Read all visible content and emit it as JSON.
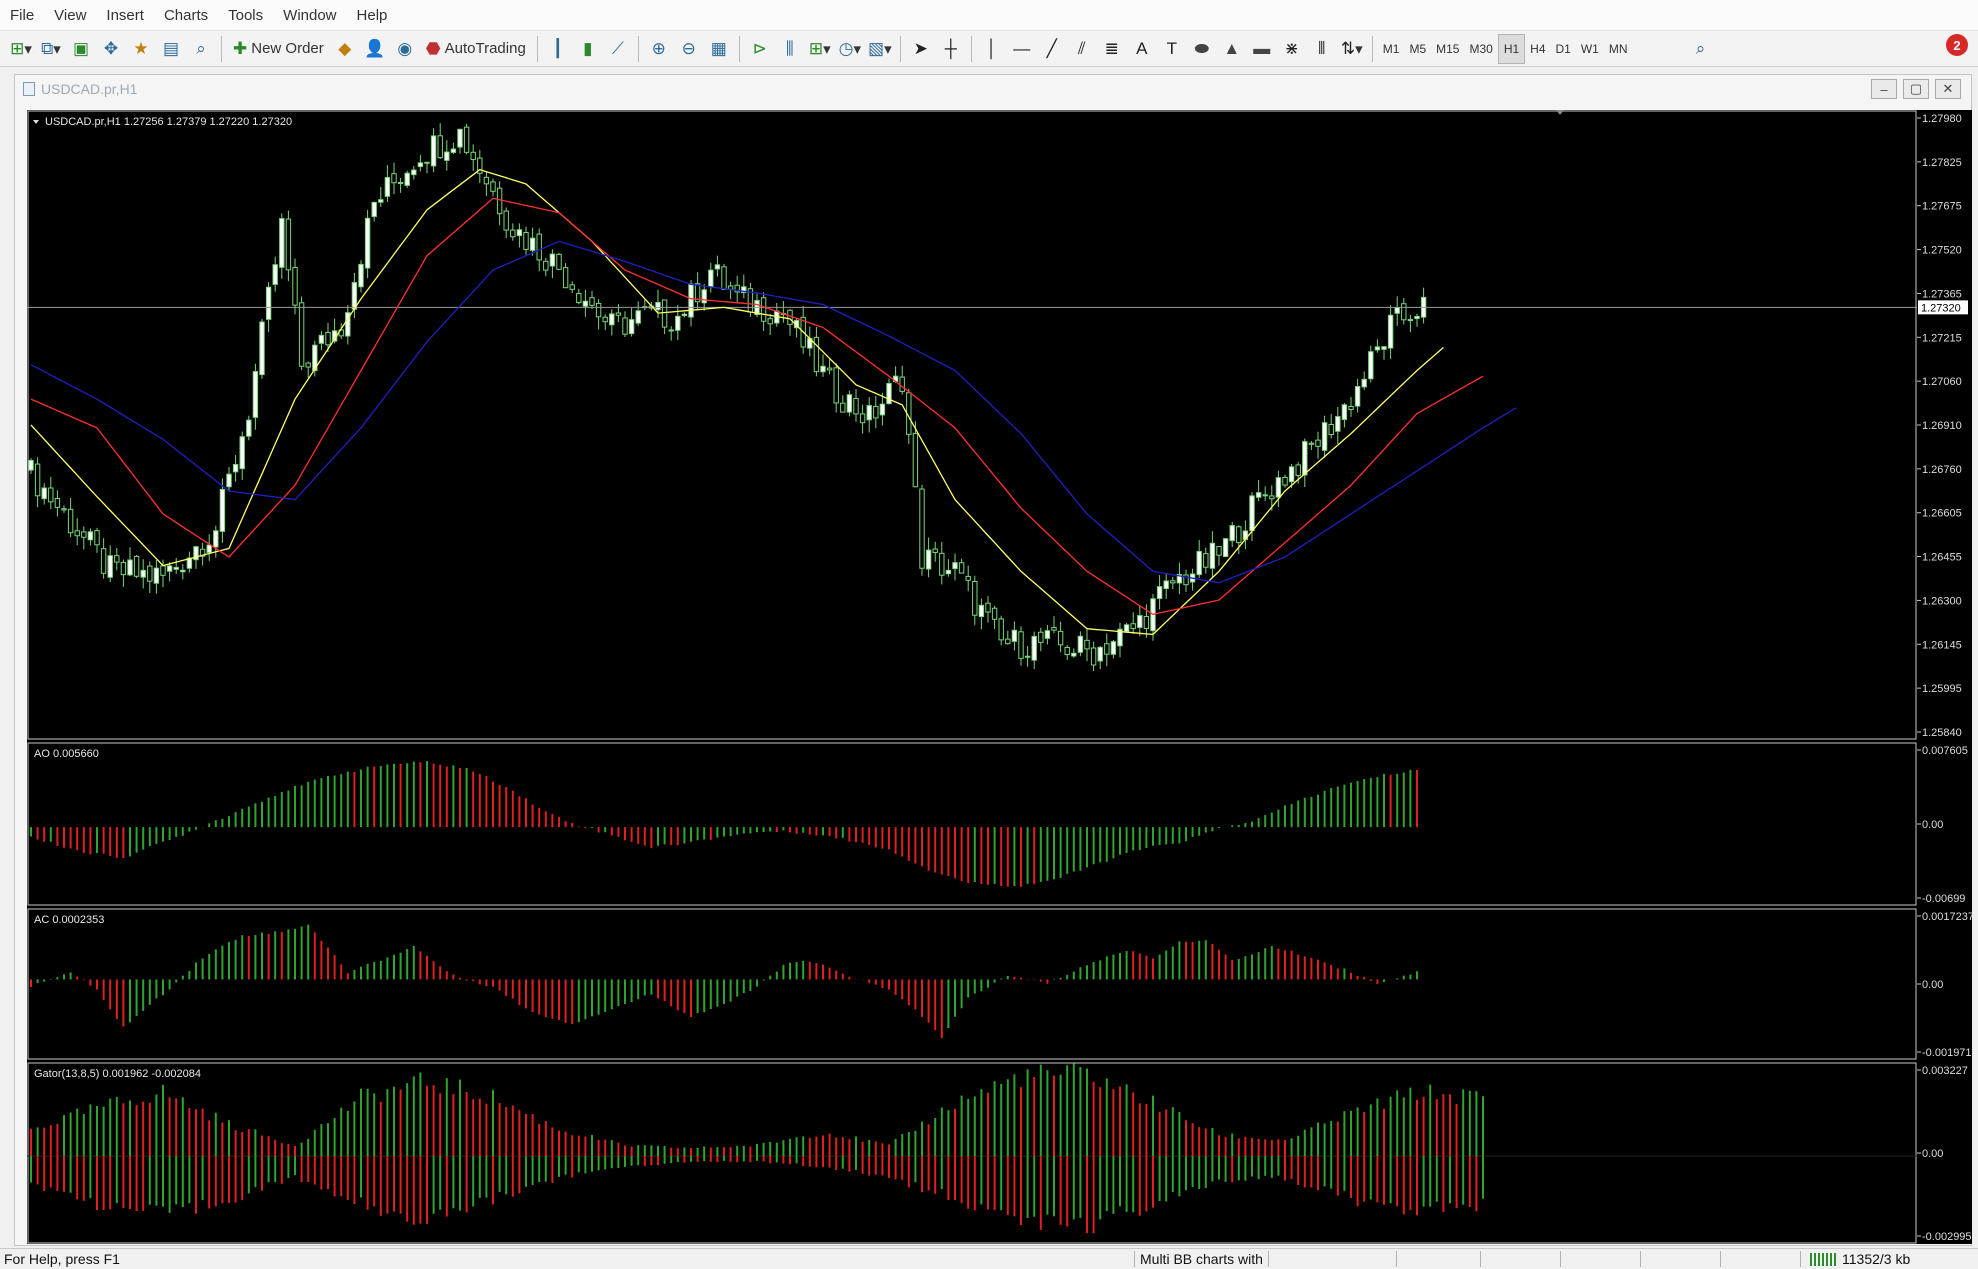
{
  "menu": [
    "File",
    "View",
    "Insert",
    "Charts",
    "Tools",
    "Window",
    "Help"
  ],
  "toolbar": {
    "new_order_label": "New Order",
    "autotrading_label": "AutoTrading",
    "timeframes": [
      "M1",
      "M5",
      "M15",
      "M30",
      "H1",
      "H4",
      "D1",
      "W1",
      "MN"
    ],
    "active_timeframe": "H1",
    "notification_count": "2"
  },
  "window": {
    "title": "USDCAD.pr,H1",
    "minimize": "–",
    "restore": "▢",
    "close": "✕"
  },
  "chart_data": [
    {
      "type": "candlestick",
      "title": "USDCAD.pr,H1 1.27256 1.27379 1.27220 1.27320",
      "current_price": 1.2732,
      "current_price_label": "1.27320",
      "y_ticks": [
        "1.27980",
        "1.27825",
        "1.27675",
        "1.27520",
        "1.27365",
        "1.27215",
        "1.27060",
        "1.26910",
        "1.26760",
        "1.26605",
        "1.26455",
        "1.26300",
        "1.26145",
        "1.25995",
        "1.25840"
      ],
      "ylim": [
        1.2584,
        1.2798
      ],
      "anchors": [
        [
          0,
          1.2674
        ],
        [
          5,
          1.266
        ],
        [
          12,
          1.264
        ],
        [
          20,
          1.2638
        ],
        [
          28,
          1.2655
        ],
        [
          33,
          1.2696
        ],
        [
          38,
          1.276
        ],
        [
          41,
          1.2712
        ],
        [
          47,
          1.2726
        ],
        [
          52,
          1.2768
        ],
        [
          59,
          1.2786
        ],
        [
          65,
          1.2793
        ],
        [
          73,
          1.276
        ],
        [
          80,
          1.2746
        ],
        [
          88,
          1.2725
        ],
        [
          93,
          1.2729
        ],
        [
          98,
          1.2729
        ],
        [
          103,
          1.2745
        ],
        [
          107,
          1.2735
        ],
        [
          114,
          1.273
        ],
        [
          121,
          1.2705
        ],
        [
          127,
          1.2693
        ],
        [
          132,
          1.2708
        ],
        [
          135,
          1.2645
        ],
        [
          140,
          1.264
        ],
        [
          147,
          1.2615
        ],
        [
          154,
          1.2615
        ],
        [
          161,
          1.2612
        ],
        [
          167,
          1.262
        ],
        [
          173,
          1.2636
        ],
        [
          180,
          1.2646
        ],
        [
          186,
          1.2665
        ],
        [
          193,
          1.268
        ],
        [
          200,
          1.27
        ],
        [
          206,
          1.2725
        ],
        [
          210,
          1.2732
        ]
      ],
      "alligator": [
        {
          "name": "Lips",
          "color": "#ffff66",
          "points": [
            [
              0,
              1.2691
            ],
            [
              10,
              1.2666
            ],
            [
              20,
              1.2642
            ],
            [
              30,
              1.2648
            ],
            [
              40,
              1.27
            ],
            [
              50,
              1.2735
            ],
            [
              60,
              1.2766
            ],
            [
              68,
              1.278
            ],
            [
              75,
              1.2775
            ],
            [
              85,
              1.2755
            ],
            [
              95,
              1.273
            ],
            [
              105,
              1.2732
            ],
            [
              115,
              1.2728
            ],
            [
              125,
              1.2705
            ],
            [
              132,
              1.2698
            ],
            [
              140,
              1.2665
            ],
            [
              150,
              1.264
            ],
            [
              160,
              1.262
            ],
            [
              170,
              1.2618
            ],
            [
              180,
              1.264
            ],
            [
              190,
              1.2668
            ],
            [
              200,
              1.2688
            ],
            [
              210,
              1.271
            ],
            [
              214,
              1.2718
            ]
          ]
        },
        {
          "name": "Teeth",
          "color": "#ff3030",
          "points": [
            [
              0,
              1.27
            ],
            [
              10,
              1.269
            ],
            [
              20,
              1.266
            ],
            [
              30,
              1.2645
            ],
            [
              40,
              1.267
            ],
            [
              50,
              1.271
            ],
            [
              60,
              1.275
            ],
            [
              70,
              1.277
            ],
            [
              80,
              1.2765
            ],
            [
              90,
              1.2745
            ],
            [
              100,
              1.2735
            ],
            [
              110,
              1.2733
            ],
            [
              120,
              1.2725
            ],
            [
              130,
              1.2708
            ],
            [
              140,
              1.269
            ],
            [
              150,
              1.2662
            ],
            [
              160,
              1.264
            ],
            [
              170,
              1.2625
            ],
            [
              180,
              1.263
            ],
            [
              190,
              1.265
            ],
            [
              200,
              1.267
            ],
            [
              210,
              1.2695
            ],
            [
              220,
              1.2708
            ]
          ]
        },
        {
          "name": "Jaw",
          "color": "#2020c0",
          "points": [
            [
              0,
              1.2712
            ],
            [
              10,
              1.27
            ],
            [
              20,
              1.2686
            ],
            [
              30,
              1.2668
            ],
            [
              40,
              1.2665
            ],
            [
              50,
              1.269
            ],
            [
              60,
              1.272
            ],
            [
              70,
              1.2745
            ],
            [
              80,
              1.2755
            ],
            [
              90,
              1.2748
            ],
            [
              100,
              1.274
            ],
            [
              110,
              1.2737
            ],
            [
              120,
              1.2733
            ],
            [
              130,
              1.2722
            ],
            [
              140,
              1.271
            ],
            [
              150,
              1.2688
            ],
            [
              160,
              1.266
            ],
            [
              170,
              1.264
            ],
            [
              180,
              1.2636
            ],
            [
              190,
              1.2645
            ],
            [
              200,
              1.266
            ],
            [
              210,
              1.2675
            ],
            [
              220,
              1.269
            ],
            [
              225,
              1.2697
            ]
          ]
        }
      ]
    },
    {
      "type": "bar",
      "title": "AO 0.005660",
      "y_ticks": [
        "0.007605",
        "0.00",
        "-0.00699"
      ],
      "ylim": [
        -0.00699,
        0.007605
      ],
      "anchors": [
        [
          0,
          -0.001
        ],
        [
          8,
          -0.0025
        ],
        [
          14,
          -0.003
        ],
        [
          22,
          -0.001
        ],
        [
          30,
          0.0012
        ],
        [
          38,
          0.0035
        ],
        [
          46,
          0.0052
        ],
        [
          54,
          0.0062
        ],
        [
          60,
          0.0064
        ],
        [
          66,
          0.0058
        ],
        [
          72,
          0.004
        ],
        [
          78,
          0.0015
        ],
        [
          82,
          0.0004
        ],
        [
          88,
          -0.0008
        ],
        [
          94,
          -0.002
        ],
        [
          100,
          -0.0015
        ],
        [
          106,
          -0.0008
        ],
        [
          112,
          -0.0004
        ],
        [
          118,
          -0.0006
        ],
        [
          124,
          -0.0013
        ],
        [
          130,
          -0.0022
        ],
        [
          136,
          -0.0042
        ],
        [
          142,
          -0.0055
        ],
        [
          150,
          -0.0058
        ],
        [
          156,
          -0.005
        ],
        [
          162,
          -0.0035
        ],
        [
          168,
          -0.0022
        ],
        [
          174,
          -0.0015
        ],
        [
          180,
          -0.0002
        ],
        [
          186,
          0.0008
        ],
        [
          192,
          0.0026
        ],
        [
          198,
          0.004
        ],
        [
          204,
          0.005
        ],
        [
          210,
          0.0057
        ]
      ]
    },
    {
      "type": "bar",
      "title": "AC 0.0002353",
      "y_ticks": [
        "0.0017237",
        "0.00",
        "-0.001971"
      ],
      "ylim": [
        -0.001971,
        0.0017237
      ],
      "anchors": [
        [
          0,
          -0.0002
        ],
        [
          6,
          0.0002
        ],
        [
          10,
          -0.0003
        ],
        [
          14,
          -0.0013
        ],
        [
          20,
          -0.0004
        ],
        [
          26,
          0.0006
        ],
        [
          32,
          0.0012
        ],
        [
          38,
          0.0013
        ],
        [
          42,
          0.0015
        ],
        [
          48,
          0.0002
        ],
        [
          54,
          0.0006
        ],
        [
          58,
          0.0009
        ],
        [
          64,
          0.0001
        ],
        [
          70,
          -0.0002
        ],
        [
          76,
          -0.0009
        ],
        [
          82,
          -0.0012
        ],
        [
          88,
          -0.0008
        ],
        [
          94,
          -0.0004
        ],
        [
          100,
          -0.001
        ],
        [
          106,
          -0.0006
        ],
        [
          110,
          -0.0002
        ],
        [
          114,
          0.0004
        ],
        [
          118,
          0.0005
        ],
        [
          124,
          0.0001
        ],
        [
          130,
          -0.0003
        ],
        [
          134,
          -0.0008
        ],
        [
          138,
          -0.0016
        ],
        [
          142,
          -0.0005
        ],
        [
          148,
          0.0001
        ],
        [
          154,
          -0.0001
        ],
        [
          160,
          0.0004
        ],
        [
          166,
          0.0008
        ],
        [
          170,
          0.0006
        ],
        [
          174,
          0.001
        ],
        [
          178,
          0.0011
        ],
        [
          182,
          0.0005
        ],
        [
          188,
          0.0009
        ],
        [
          194,
          0.0006
        ],
        [
          200,
          0.0002
        ],
        [
          204,
          -0.0001
        ],
        [
          210,
          0.0002
        ]
      ]
    },
    {
      "type": "bar",
      "title": "Gator(13,8,5) 0.001962 -0.002084",
      "y_ticks": [
        "0.003227",
        "0.00",
        "-0.002995"
      ],
      "ylim": [
        -0.002995,
        0.003227
      ],
      "upper": [
        [
          0,
          0.001
        ],
        [
          10,
          0.0018
        ],
        [
          20,
          0.0024
        ],
        [
          30,
          0.0012
        ],
        [
          40,
          0.0004
        ],
        [
          50,
          0.0022
        ],
        [
          60,
          0.0028
        ],
        [
          70,
          0.0022
        ],
        [
          80,
          0.001
        ],
        [
          90,
          0.0004
        ],
        [
          100,
          0.0003
        ],
        [
          110,
          0.0004
        ],
        [
          120,
          0.0009
        ],
        [
          130,
          0.0004
        ],
        [
          140,
          0.002
        ],
        [
          150,
          0.003
        ],
        [
          160,
          0.0031
        ],
        [
          170,
          0.002
        ],
        [
          180,
          0.0008
        ],
        [
          190,
          0.0006
        ],
        [
          200,
          0.0016
        ],
        [
          210,
          0.0024
        ],
        [
          220,
          0.0022
        ]
      ],
      "lower": [
        [
          0,
          -0.001
        ],
        [
          10,
          -0.0018
        ],
        [
          20,
          -0.0022
        ],
        [
          30,
          -0.0016
        ],
        [
          40,
          -0.0008
        ],
        [
          50,
          -0.0018
        ],
        [
          60,
          -0.0024
        ],
        [
          70,
          -0.0016
        ],
        [
          80,
          -0.0008
        ],
        [
          90,
          -0.0004
        ],
        [
          100,
          -0.0002
        ],
        [
          110,
          -0.0002
        ],
        [
          120,
          -0.0004
        ],
        [
          130,
          -0.0008
        ],
        [
          140,
          -0.0016
        ],
        [
          150,
          -0.0024
        ],
        [
          160,
          -0.0026
        ],
        [
          170,
          -0.0018
        ],
        [
          180,
          -0.001
        ],
        [
          190,
          -0.0008
        ],
        [
          200,
          -0.0016
        ],
        [
          210,
          -0.002
        ],
        [
          220,
          -0.0018
        ]
      ]
    }
  ],
  "status": {
    "help": "For Help, press F1",
    "profile": "Multi BB charts with",
    "traffic": "11352/3 kb"
  }
}
